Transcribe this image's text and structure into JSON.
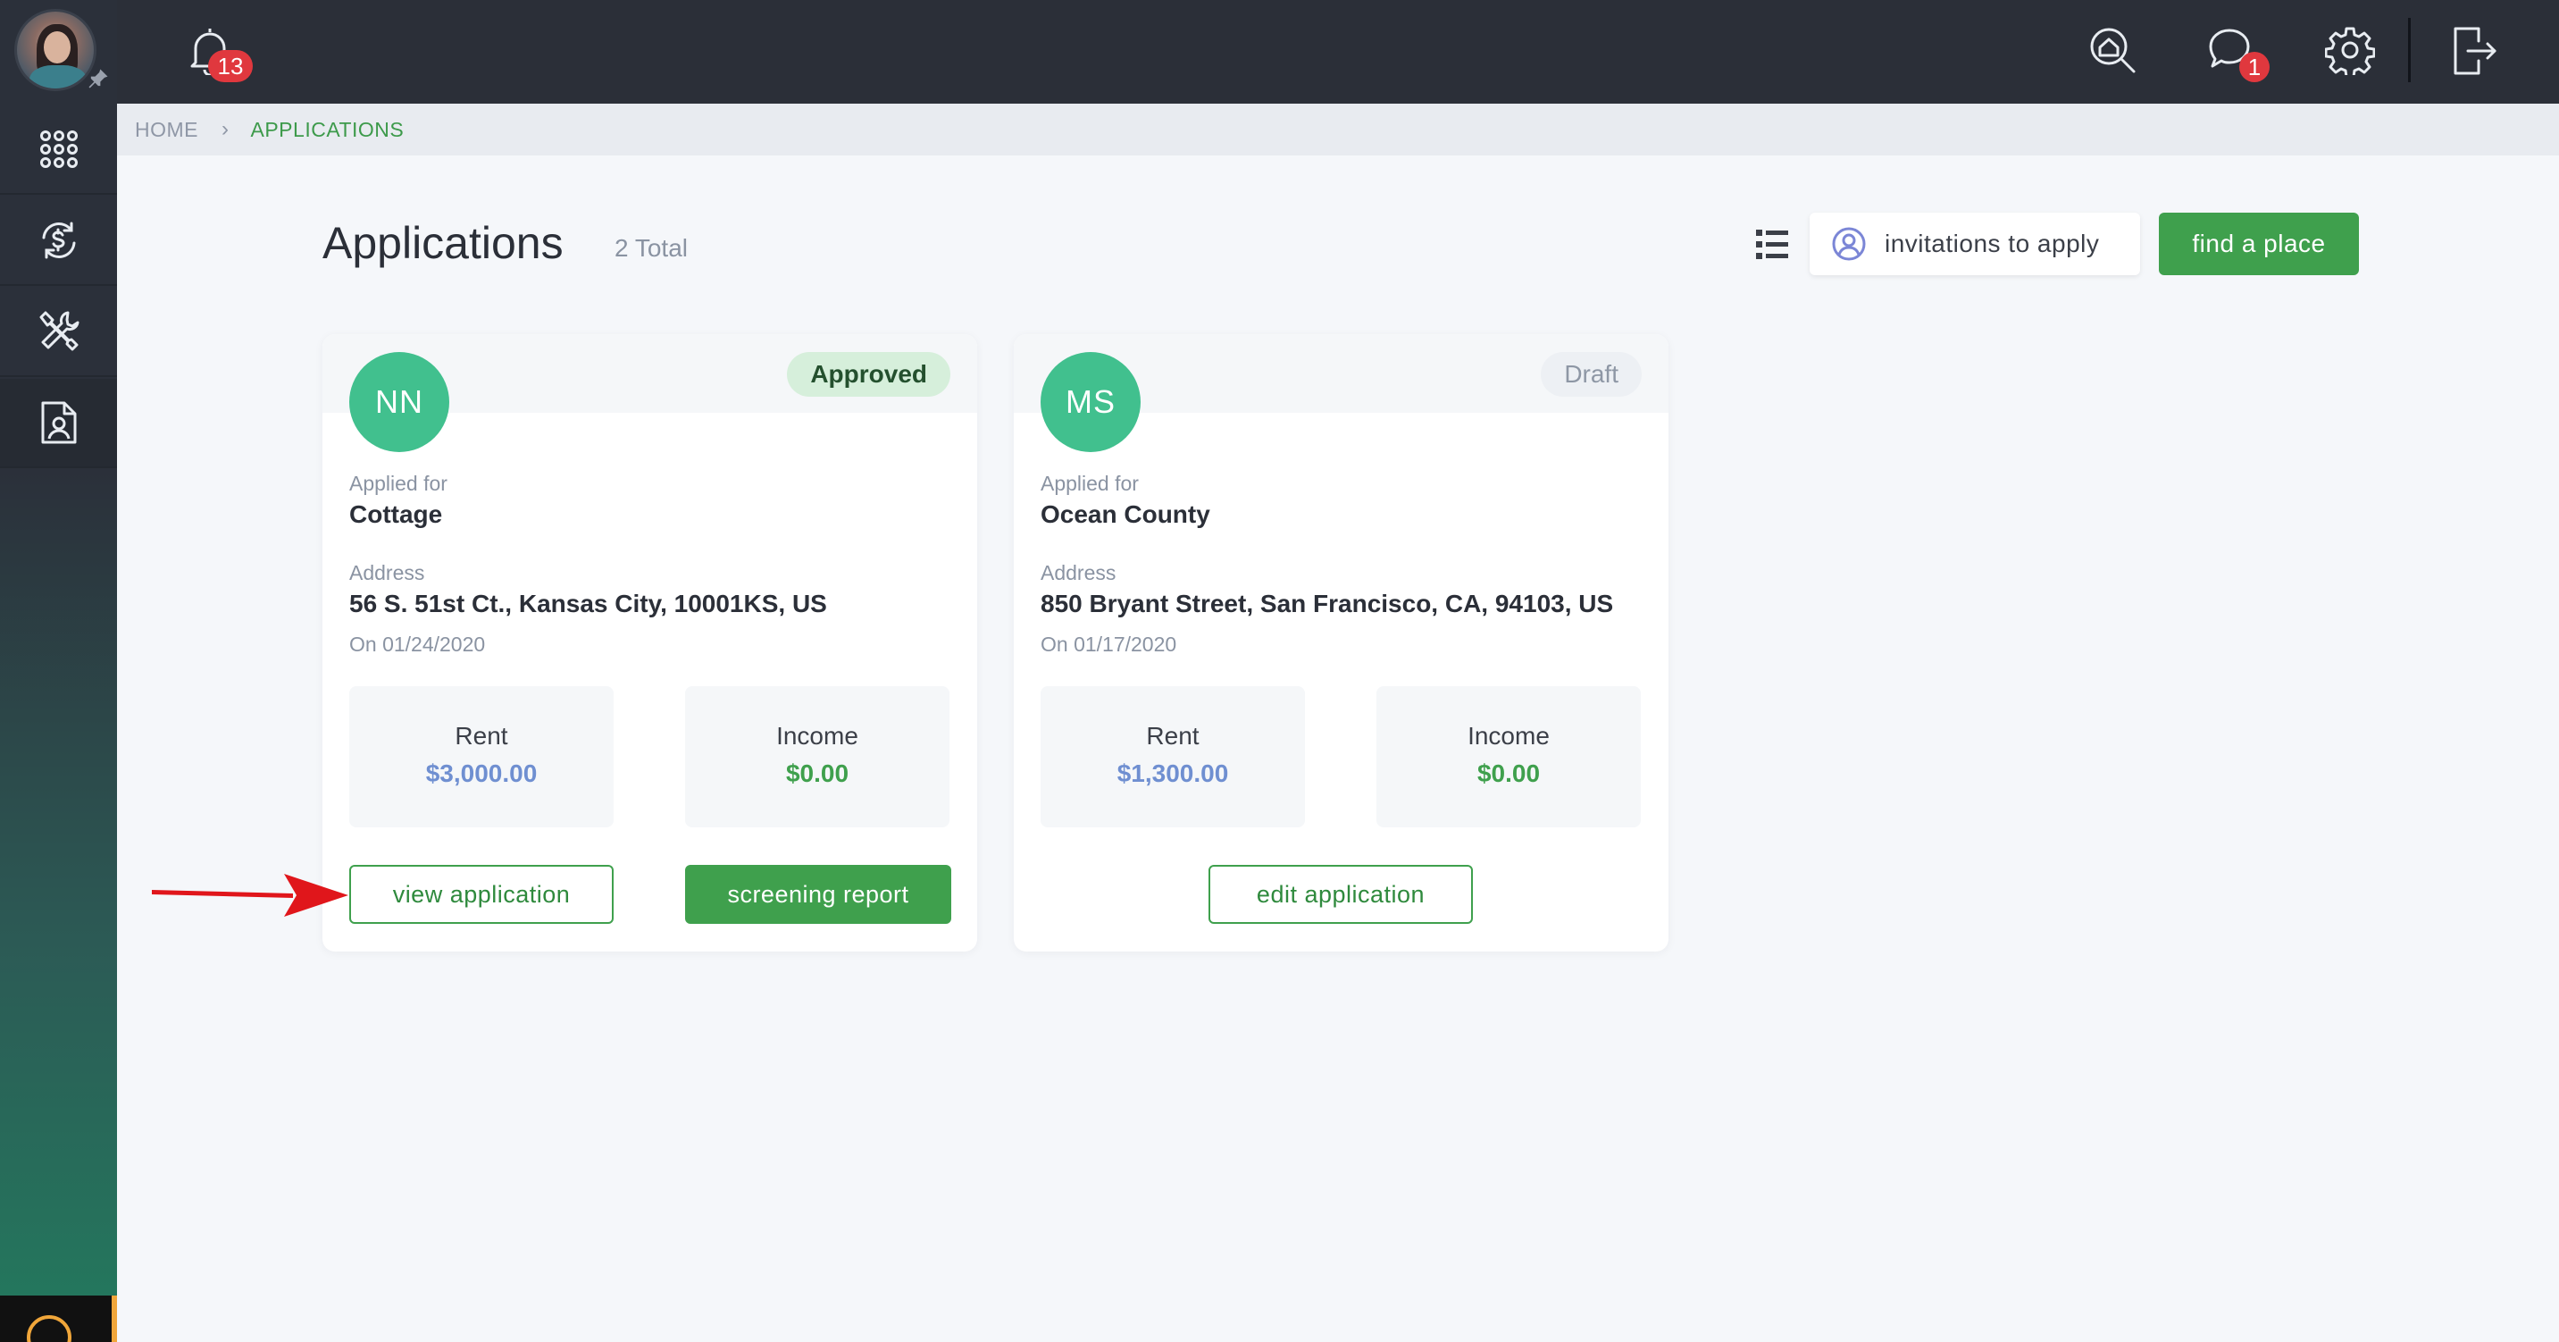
{
  "topbar": {
    "notifications_count": "13",
    "messages_count": "1"
  },
  "breadcrumb": {
    "home": "HOME",
    "current": "APPLICATIONS"
  },
  "header": {
    "title": "Applications",
    "total": "2 Total",
    "invitations_label": "invitations to apply",
    "find_place_label": "find a place"
  },
  "applications": [
    {
      "initials": "NN",
      "status": "Approved",
      "applied_for_label": "Applied for",
      "applied_for": "Cottage",
      "address_label": "Address",
      "address": "56 S. 51st Ct., Kansas City, 10001KS, US",
      "date": "On 01/24/2020",
      "rent_label": "Rent",
      "rent": "$3,000.00",
      "income_label": "Income",
      "income": "$0.00",
      "primary_action": "view application",
      "secondary_action": "screening report"
    },
    {
      "initials": "MS",
      "status": "Draft",
      "applied_for_label": "Applied for",
      "applied_for": "Ocean County",
      "address_label": "Address",
      "address": "850 Bryant Street, San Francisco, CA, 94103, US",
      "date": "On 01/17/2020",
      "rent_label": "Rent",
      "rent": "$1,300.00",
      "income_label": "Income",
      "income": "$0.00",
      "primary_action": "edit application"
    }
  ],
  "icons": {
    "sidebar": [
      "apps-grid-icon",
      "payments-cycle-icon",
      "maintenance-tools-icon",
      "applications-document-icon"
    ],
    "topbar": [
      "bell-icon",
      "home-search-icon",
      "chat-bubble-icon",
      "gear-icon",
      "logout-icon"
    ]
  },
  "colors": {
    "accent_green": "#3fa04d",
    "avatar_green": "#41c08e",
    "rent_blue": "#6f8fd1",
    "badge_red": "#e0383e",
    "topbar": "#2b2f38"
  }
}
